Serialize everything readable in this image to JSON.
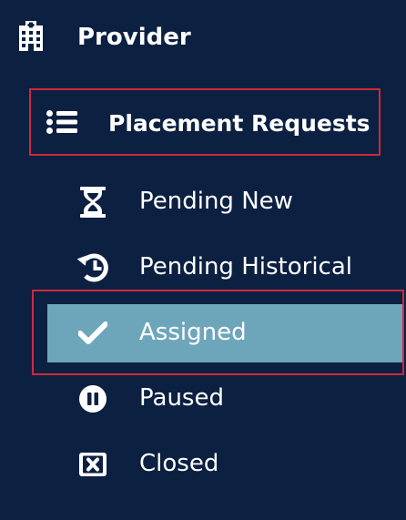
{
  "nav": {
    "provider": {
      "label": "Provider",
      "icon": "hospital-icon"
    },
    "placement_requests": {
      "label": "Placement Requests",
      "icon": "list-icon"
    },
    "items": [
      {
        "label": "Pending New",
        "icon": "hourglass-icon"
      },
      {
        "label": "Pending Historical",
        "icon": "history-icon"
      },
      {
        "label": "Assigned",
        "icon": "check-icon",
        "active": true
      },
      {
        "label": "Paused",
        "icon": "pause-circle-icon"
      },
      {
        "label": "Closed",
        "icon": "close-box-icon"
      }
    ]
  },
  "colors": {
    "background": "#0c2041",
    "active_item": "#6da6bb",
    "highlight_border": "#d0283b",
    "text": "#ffffff"
  }
}
